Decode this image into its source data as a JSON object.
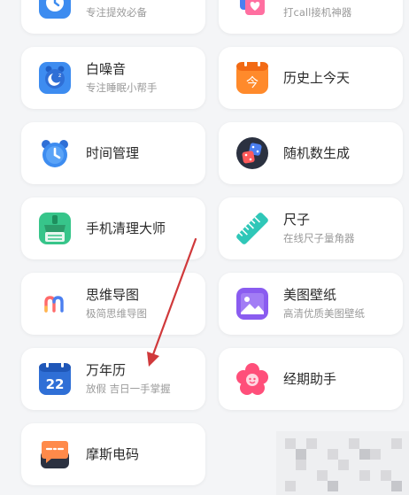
{
  "apps": [
    {
      "title": "",
      "subtitle": "专注提效必备",
      "icon": "clock-blue-icon"
    },
    {
      "title": "",
      "subtitle": "打call接机神器",
      "icon": "heart-card-icon"
    },
    {
      "title": "白噪音",
      "subtitle": "专注睡眠小帮手",
      "icon": "sleep-alarm-icon"
    },
    {
      "title": "历史上今天",
      "subtitle": "",
      "icon": "calendar-today-icon"
    },
    {
      "title": "时间管理",
      "subtitle": "",
      "icon": "alarm-clock-icon"
    },
    {
      "title": "随机数生成",
      "subtitle": "",
      "icon": "dice-icon"
    },
    {
      "title": "手机清理大师",
      "subtitle": "",
      "icon": "broom-icon"
    },
    {
      "title": "尺子",
      "subtitle": "在线尺子量角器",
      "icon": "ruler-icon"
    },
    {
      "title": "思维导图",
      "subtitle": "极简思维导图",
      "icon": "mindmap-m-icon"
    },
    {
      "title": "美图壁纸",
      "subtitle": "高清优质美图壁纸",
      "icon": "wallpaper-icon"
    },
    {
      "title": "万年历",
      "subtitle": "放假 吉日一手掌握",
      "icon": "calendar-22-icon",
      "icon_text": "22"
    },
    {
      "title": "经期助手",
      "subtitle": "",
      "icon": "flower-icon"
    },
    {
      "title": "摩斯电码",
      "subtitle": "",
      "icon": "morse-chat-icon"
    }
  ],
  "colors": {
    "background": "#f4f5f7",
    "card": "#ffffff",
    "arrow": "#d0393b"
  }
}
